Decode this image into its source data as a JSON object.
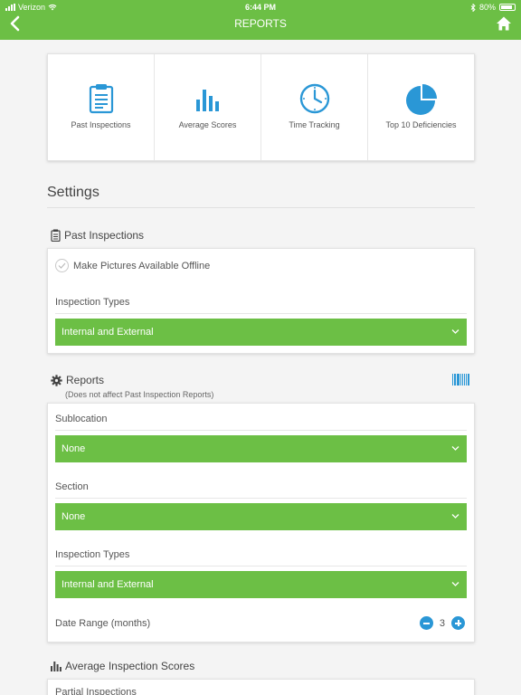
{
  "status": {
    "carrier": "Verizon",
    "time": "6:44 PM",
    "battery": "80%"
  },
  "nav": {
    "title": "REPORTS"
  },
  "tiles": [
    {
      "label": "Past Inspections",
      "icon": "clipboard-icon"
    },
    {
      "label": "Average Scores",
      "icon": "bar-chart-icon"
    },
    {
      "label": "Time Tracking",
      "icon": "clock-icon"
    },
    {
      "label": "Top 10 Deficiencies",
      "icon": "pie-chart-icon"
    }
  ],
  "settings": {
    "title": "Settings"
  },
  "past_inspections": {
    "heading": "Past Inspections",
    "offline_label": "Make Pictures Available Offline",
    "inspection_types_label": "Inspection Types",
    "inspection_types_value": "Internal and External"
  },
  "reports": {
    "heading": "Reports",
    "subheading": "(Does not affect Past Inspection Reports)",
    "sublocation_label": "Sublocation",
    "sublocation_value": "None",
    "section_label": "Section",
    "section_value": "None",
    "inspection_types_label": "Inspection Types",
    "inspection_types_value": "Internal and External",
    "date_range_label": "Date Range (months)",
    "date_range_value": "3"
  },
  "average_scores": {
    "heading": "Average Inspection Scores",
    "partial_label": "Partial Inspections"
  },
  "colors": {
    "accent_green": "#6cbf45",
    "accent_blue": "#2a97d6"
  }
}
